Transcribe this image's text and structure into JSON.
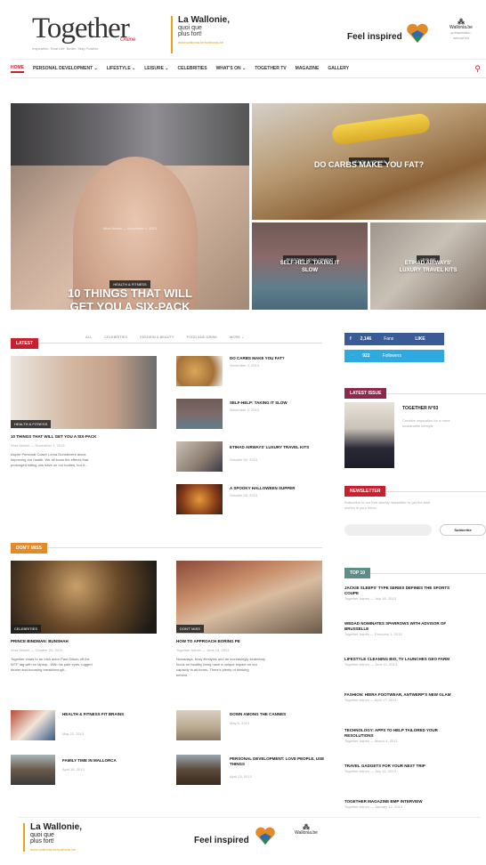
{
  "header": {
    "logo": "Together",
    "logo_sub": "Online",
    "logo_tagline": "Inspiration. Real Life. Better. Stay Positive.",
    "banner_title": "La Wallonie,",
    "banner_line1": "quoi que",
    "banner_line2": "plus fort!",
    "banner_url": "www.wallonia.be/wallonia-be",
    "feel_inspired": "Feel inspired",
    "wallonia": "Wallonia.be",
    "wallonia_sub": "ENTREPRISES • INNOVATION"
  },
  "nav": {
    "items": [
      "Home",
      "Personal Development ⌄",
      "Lifestyle ⌄",
      "Leisure ⌄",
      "Celebrities",
      "What's On ⌄",
      "Together TV",
      "Magazine",
      "Gallery"
    ]
  },
  "hero": {
    "main": {
      "tag": "Health & Fitness",
      "title_line1": "10 Things That Will",
      "title_line2": "Get You A Six-Pack",
      "meta": "Nina Nissim — November 1, 2013"
    },
    "r1": {
      "tag": "Health & Fitness",
      "title": "Do Carbs Make You Fat?"
    },
    "r2": {
      "tag": "Personal Development",
      "title_line1": "Self-Help: Taking It",
      "title_line2": "Slow"
    },
    "r3": {
      "tag": "Leisure",
      "title_line1": "Etihad Airways'",
      "title_line2": "Luxury Travel Kits"
    }
  },
  "latest": {
    "label": "Latest",
    "filters": [
      "All",
      "Celebrities",
      "Fashion & Beauty",
      "Food and Drink",
      "More ⌄"
    ],
    "feature": {
      "tag": "Health & Fitness",
      "title": "10 Things That Will Get You A Six-Pack",
      "meta": "Nina Nissim — November 1, 2013",
      "excerpt_line1": "Aspire Personal Coach Lorna Dunstevere alook",
      "excerpt_line2": "improving our health. We all know the effects that",
      "excerpt_line3": "prolonged sitting can have on our bodies, but if..."
    },
    "items": [
      {
        "title": "Do Carbs Make You Fat?",
        "meta": "November 3, 2013"
      },
      {
        "title": "Self-Help: Taking It Slow",
        "meta": "November 2, 2013"
      },
      {
        "title": "Etihad Airways' Luxury Travel Kits",
        "meta": "October 30, 2013"
      },
      {
        "title": "A Spooky Halloween Supper",
        "meta": "October 28, 2013"
      }
    ]
  },
  "social": {
    "fb_count": "2,146",
    "fb_label": "Fans",
    "fb_action": "LIKE",
    "tw_count": "922",
    "tw_label": "Followers"
  },
  "latest_issue": {
    "label": "Latest Issue",
    "title": "Together N°03",
    "desc_line1": "Creative inspiration for a more",
    "desc_line2": "sustainable lifestyle"
  },
  "newsletter": {
    "label": "Newsletter",
    "desc_line1": "Subscribe to our free weekly newsletter to get the best",
    "desc_line2": "stories in your inbox.",
    "button": "Subscribe"
  },
  "dont_miss": {
    "label": "Don't Miss",
    "feature1": {
      "tag": "Celebrities",
      "title": "Prince Bindman: Bunshah",
      "meta": "Nina Nissim — October 22, 2013",
      "excerpt_line1": "Together chats to an Irish actor Paul Gilson off the",
      "excerpt_line2": "WTF tag with on laptop...With his pale eyes, rugged",
      "excerpt_line3": "dealer and booming breakthrough..."
    },
    "feature2": {
      "tag": "Don't Miss",
      "title": "How To Approach Boring Pe",
      "meta": "Together Admin — June 18, 2013",
      "excerpt_line1": "Nowadays, busy lifestyles and an increasingly sedentary",
      "excerpt_line2": "focus on healthy living have a unique impact on our",
      "excerpt_line3": "capacity in all forms. There's plenty of thinking",
      "excerpt_line4": "behind."
    },
    "items_left": [
      {
        "title": "Health & Fitness Fit Brains",
        "meta": "May 22, 2013"
      },
      {
        "title": "Family Time In Mallorca",
        "meta": "April 18, 2013"
      }
    ],
    "items_right": [
      {
        "title": "Down Among The Cannes",
        "meta": "May 6, 2013"
      },
      {
        "title": "Personal Development: Love People, Use Things",
        "meta": "April 23, 2013"
      }
    ]
  },
  "top10": {
    "label": "Top 10",
    "items": [
      {
        "title_line1": "Jackie Sleeps' Type Series Defines The Sports",
        "title_line2": "Coupe",
        "meta": "Together Admin — July 18, 2013"
      },
      {
        "title_line1": "Wedad Nominates Sparrows With Advisor Of",
        "title_line2": "Brusselle",
        "meta": "Together Admin — February 1, 2013"
      },
      {
        "title_line1": "Lifestyle Cleaning Bio, TV Launches Geo Farm",
        "title_line2": "",
        "meta": "Together Admin — June 11, 2013"
      },
      {
        "title_line1": "Fashion: Hiera Footwear, Antwerp's New Glam",
        "title_line2": "",
        "meta": "Together Admin — April 17, 2013"
      },
      {
        "title_line1": "Technology: Apps To Help Tailored Your",
        "title_line2": "Resolutions",
        "meta": "Together Admin — March 4, 2013"
      },
      {
        "title_line1": "Travel Gadgets For Your Next Trip",
        "title_line2": "",
        "meta": "Together Admin — July 31, 2013"
      },
      {
        "title_line1": "Together Magazine BMP Interview",
        "title_line2": "",
        "meta": "Together Admin — January 12, 2013"
      }
    ]
  },
  "footer_ad": {
    "line1": "La Wallonie,",
    "line2": "quoi que",
    "line3": "plus fort!",
    "url": "www.wallonia.be/wallonia-be",
    "feel": "Feel inspired",
    "wallonia": "Wallonia.be"
  },
  "colors": {
    "accent": "#c8202f",
    "orange": "#e38b2a",
    "teal": "#5d8d87",
    "maroon": "#8b2a4c",
    "facebook": "#3b5b97",
    "twitter": "#2faae0"
  }
}
